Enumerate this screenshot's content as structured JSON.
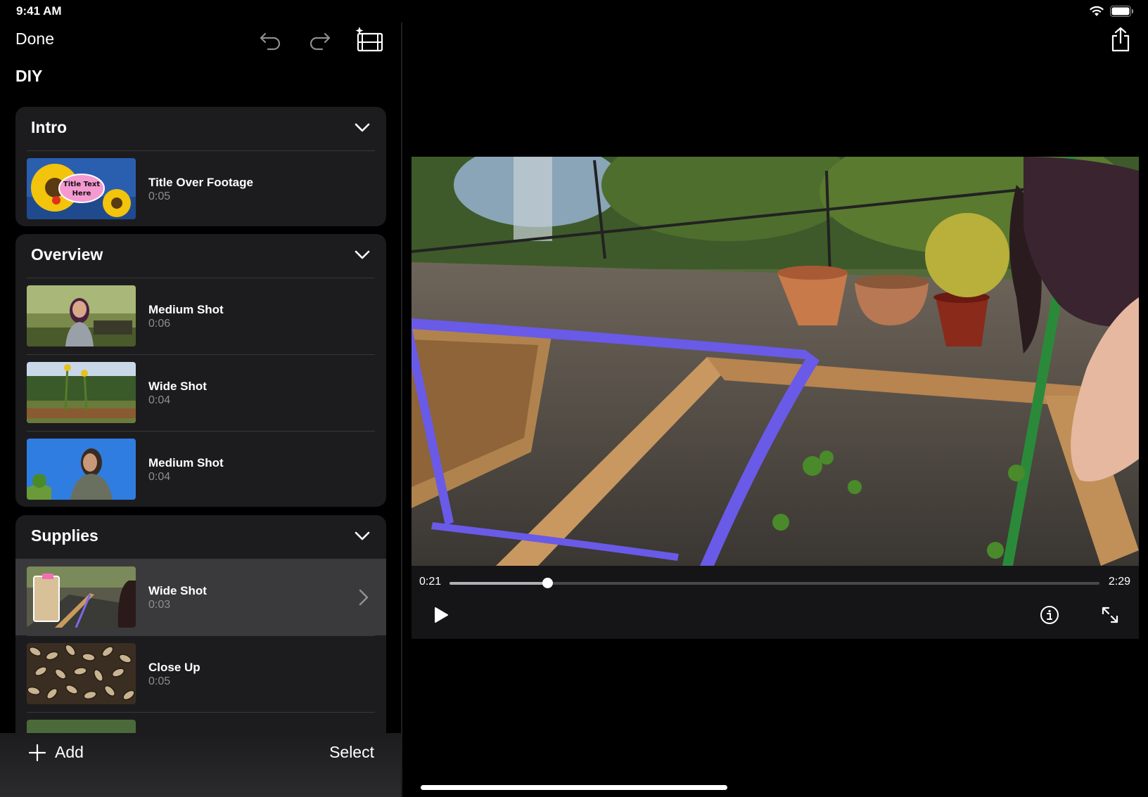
{
  "status": {
    "time": "9:41 AM"
  },
  "toolbar": {
    "done_label": "Done"
  },
  "project": {
    "title": "DIY"
  },
  "sections": [
    {
      "title": "Intro",
      "clips": [
        {
          "name": "Title Over Footage",
          "duration": "0:05",
          "thumb_text_1": "Title Text",
          "thumb_text_2": "Here"
        }
      ]
    },
    {
      "title": "Overview",
      "clips": [
        {
          "name": "Medium Shot",
          "duration": "0:06"
        },
        {
          "name": "Wide Shot",
          "duration": "0:04"
        },
        {
          "name": "Medium Shot",
          "duration": "0:04"
        }
      ]
    },
    {
      "title": "Supplies",
      "clips": [
        {
          "name": "Wide Shot",
          "duration": "0:03",
          "selected": true
        },
        {
          "name": "Close Up",
          "duration": "0:05"
        }
      ]
    }
  ],
  "bottom_bar": {
    "add_label": "Add",
    "select_label": "Select"
  },
  "player": {
    "current_time": "0:21",
    "total_time": "2:29",
    "progress": 0.15
  },
  "icons": [
    "wifi-icon",
    "battery-icon",
    "undo-icon",
    "redo-icon",
    "magic-movie-icon",
    "chevron-down-icon",
    "chevron-right-icon",
    "plus-icon",
    "share-icon",
    "play-icon",
    "info-icon",
    "expand-icon"
  ]
}
